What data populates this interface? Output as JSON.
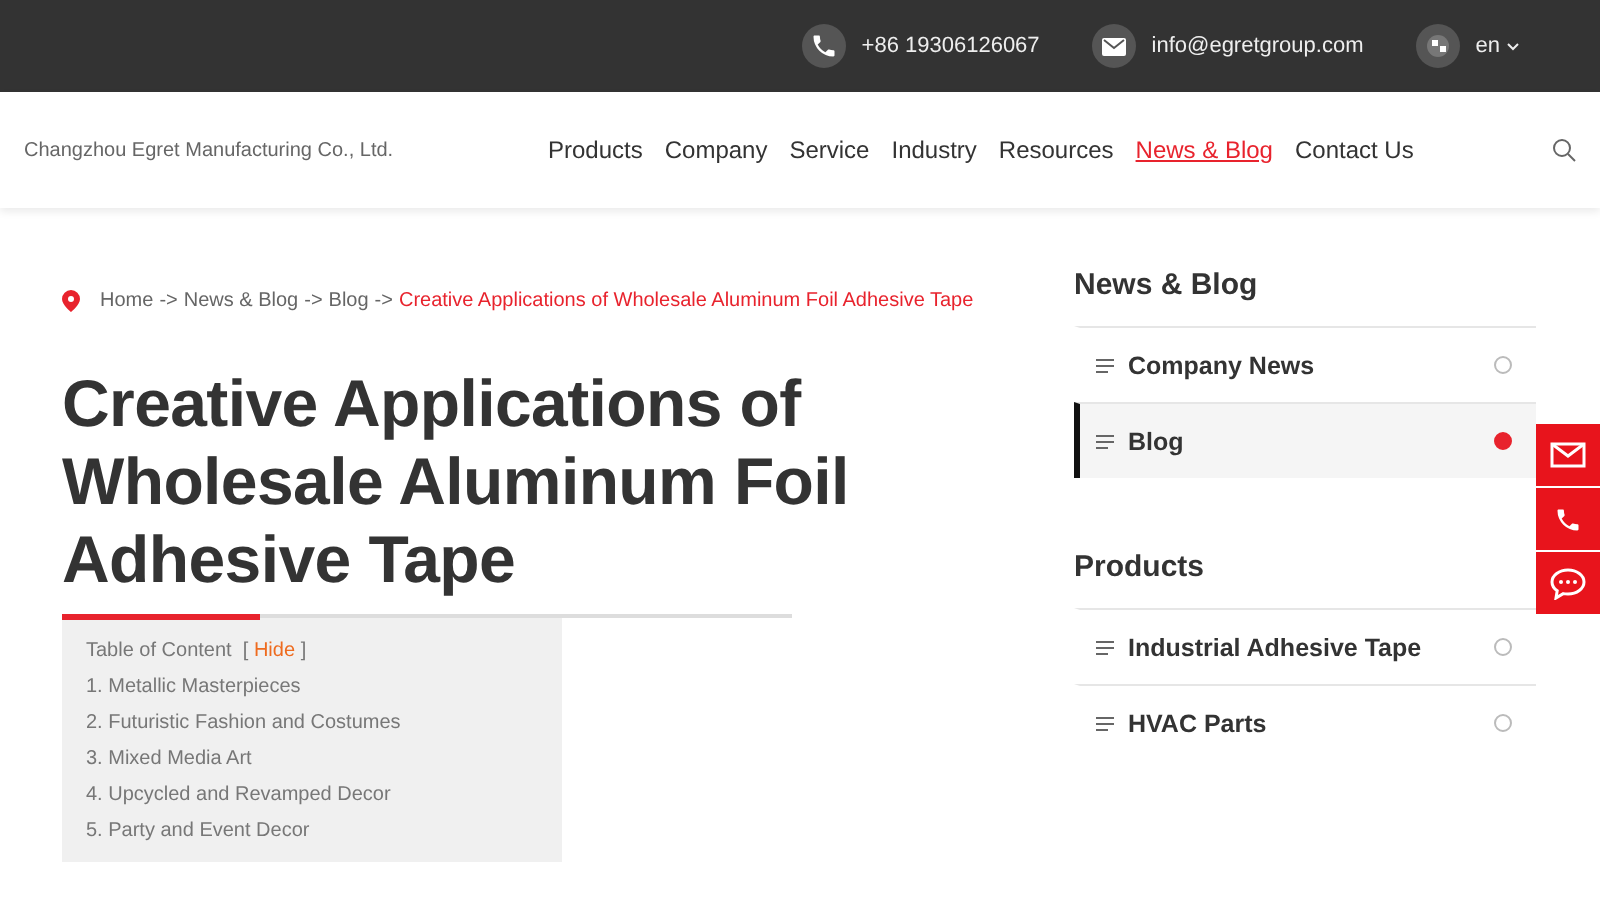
{
  "top_bar": {
    "phone": "+86 19306126067",
    "email": "info@egretgroup.com",
    "language": "en"
  },
  "header": {
    "company": "Changzhou Egret Manufacturing Co., Ltd.",
    "nav": [
      {
        "label": "Products",
        "selected": false
      },
      {
        "label": "Company",
        "selected": false
      },
      {
        "label": "Service",
        "selected": false
      },
      {
        "label": "Industry",
        "selected": false
      },
      {
        "label": "Resources",
        "selected": false
      },
      {
        "label": "News & Blog",
        "selected": true
      },
      {
        "label": "Contact Us",
        "selected": false
      }
    ]
  },
  "breadcrumb": [
    {
      "kind": "link",
      "text": "Home"
    },
    {
      "kind": "sep",
      "text": "->"
    },
    {
      "kind": "link",
      "text": "News & Blog"
    },
    {
      "kind": "sep",
      "text": "->"
    },
    {
      "kind": "link",
      "text": "Blog"
    },
    {
      "kind": "sep",
      "text": "->"
    },
    {
      "kind": "current",
      "text": "Creative Applications of Wholesale Aluminum Foil Adhesive Tape"
    }
  ],
  "article": {
    "title": "Creative Applications of Wholesale Aluminum Foil Adhesive Tape",
    "toc": {
      "title": "Table of Content",
      "open_bracket": "[",
      "toggle": "Hide",
      "close_bracket": "]",
      "items": [
        "1. Metallic Masterpieces",
        "2. Futuristic Fashion and Costumes",
        "3. Mixed Media Art",
        "4. Upcycled and Revamped Decor",
        "5. Party and Event Decor"
      ]
    }
  },
  "sidebar": [
    {
      "heading": "News & Blog",
      "items": [
        {
          "label": "Company News",
          "selected": false
        },
        {
          "label": "Blog",
          "selected": true
        }
      ]
    },
    {
      "heading": "Products",
      "items": [
        {
          "label": "Industrial Adhesive Tape",
          "selected": false
        },
        {
          "label": "HVAC Parts",
          "selected": false
        }
      ]
    }
  ]
}
